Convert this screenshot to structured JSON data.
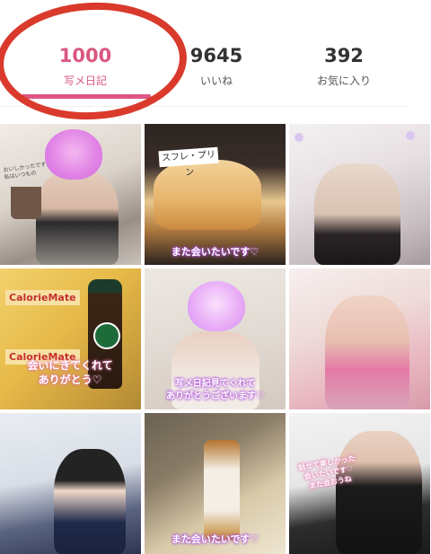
{
  "stats": [
    {
      "key": "diary",
      "value": "1000",
      "label": "写メ日記",
      "active": true
    },
    {
      "key": "likes",
      "value": "9645",
      "label": "いいね",
      "active": false
    },
    {
      "key": "favorites",
      "value": "392",
      "label": "お気に入り",
      "active": false
    }
  ],
  "colors": {
    "accent": "#e05585",
    "annotation_circle": "#d93a2c",
    "caption_glow": "#b45adb"
  },
  "grid": {
    "tiles": [
      {
        "note": "おいしかったですか\n私はいつもの"
      },
      {
        "caption": "また会いたいです♡",
        "label": "スフレ・プリン"
      },
      {},
      {
        "caption": "会いにきてくれて\nありがとう♡",
        "brand1": "CalorieMate",
        "brand2": "CalorieMate"
      },
      {
        "caption": "写メ日記見てくれて\nありがとうございます♡"
      },
      {},
      {},
      {
        "caption": "また会いたいです♡"
      },
      {
        "caption": "話せて楽しかった\n会いたいです♡\nまた会おうね"
      }
    ]
  }
}
